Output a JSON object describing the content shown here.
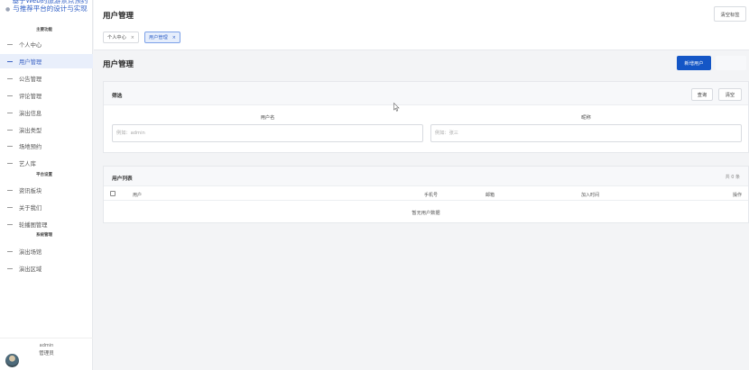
{
  "brand": {
    "title": "基于Web的旅游景点预约与推荐平台的设计与实现"
  },
  "sidebar": {
    "groups": [
      "主要功能",
      "平台设置",
      "系统管理"
    ],
    "items": [
      {
        "label": "个人中心"
      },
      {
        "label": "用户管理"
      },
      {
        "label": "公告管理"
      },
      {
        "label": "评论管理"
      },
      {
        "label": "演出信息"
      },
      {
        "label": "演出类型"
      },
      {
        "label": "场地预约"
      },
      {
        "label": "艺人库"
      },
      {
        "label": "资讯板块"
      },
      {
        "label": "关于我们"
      },
      {
        "label": "轮播图管理"
      },
      {
        "label": "演出场馆"
      },
      {
        "label": "演出区域"
      }
    ],
    "active_index": 1,
    "user": {
      "name": "admin",
      "role": "管理员"
    }
  },
  "header": {
    "title": "用户管理",
    "clear_tabs_label": "清空标签",
    "tabs": [
      {
        "label": "个人中心",
        "close": "×"
      },
      {
        "label": "用户管理",
        "close": "×"
      }
    ]
  },
  "main": {
    "title": "用户管理",
    "add_user_label": "新增用户",
    "filter": {
      "title": "筛选",
      "search_label": "查询",
      "reset_label": "清空",
      "fields": [
        {
          "label": "用户名",
          "placeholder": "例如：admin"
        },
        {
          "label": "昵称",
          "placeholder": "例如：张三"
        }
      ]
    },
    "list": {
      "title": "用户列表",
      "count": "共 0 条",
      "columns": [
        "用户",
        "手机号",
        "邮箱",
        "加入时间",
        "操作"
      ],
      "empty_text": "暂无用户数据"
    }
  },
  "colors": {
    "primary": "#1456c6",
    "active_bg": "#e9effb",
    "brand_text": "#2f5fc6"
  }
}
